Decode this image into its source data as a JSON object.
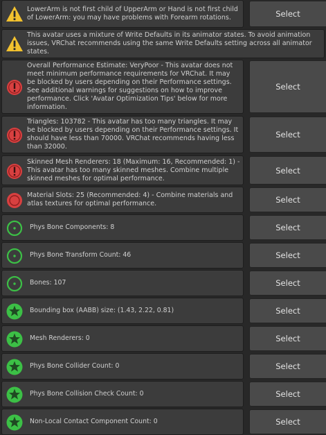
{
  "colors": {
    "warning": "#f2c12e",
    "error": "#d84040",
    "info_green": "#3cc046",
    "panel_bg": "#3c3c3c",
    "button_bg": "#4a4a4a"
  },
  "rows": [
    {
      "icon": "warning-icon",
      "text": "LowerArm is not first child of UpperArm or Hand is not first child of LowerArm: you may have problems with Forearm rotations.",
      "button": "Select"
    },
    {
      "icon": "warning-icon",
      "text": "This avatar uses a mixture of Write Defaults in its animator states. To avoid animation issues, VRChat recommends using the same Write Defaults setting across all animator states."
    },
    {
      "icon": "error-icon",
      "text": "Overall Performance Estimate: VeryPoor - This avatar does not meet minimum performance requirements for VRChat. It may be blocked by users depending on their Performance settings. See additional warnings for suggestions on how to improve performance. Click 'Avatar Optimization Tips' below for more information.",
      "button": "Select"
    },
    {
      "icon": "error-icon",
      "text": "Triangles: 103782 - This avatar has too many triangles. It may be blocked by users depending on their Performance settings. It should have less than 70000. VRChat recommends having less than 32000.",
      "button": "Select"
    },
    {
      "icon": "error-icon",
      "text": "Skinned Mesh Renderers: 18 (Maximum: 16, Recommended: 1) - This avatar has too many skinned meshes. Combine multiple skinned meshes for optimal performance.",
      "button": "Select"
    },
    {
      "icon": "error-dot-icon",
      "text": "Material Slots: 25 (Recommended: 4) - Combine materials and atlas textures for optimal performance.",
      "button": "Select"
    },
    {
      "icon": "good-circle-icon",
      "text": "Phys Bone Components: 8",
      "button": "Select"
    },
    {
      "icon": "good-circle-icon",
      "text": "Phys Bone Transform Count: 46",
      "button": "Select"
    },
    {
      "icon": "good-circle-icon",
      "text": "Bones: 107",
      "button": "Select"
    },
    {
      "icon": "excellent-star-icon",
      "text": "Bounding box (AABB) size: (1.43, 2.22, 0.81)",
      "button": "Select"
    },
    {
      "icon": "excellent-star-icon",
      "text": "Mesh Renderers: 0",
      "button": "Select"
    },
    {
      "icon": "excellent-star-icon",
      "text": "Phys Bone Collider Count: 0",
      "button": "Select"
    },
    {
      "icon": "excellent-star-icon",
      "text": "Phys Bone Collision Check Count: 0",
      "button": "Select"
    },
    {
      "icon": "excellent-star-icon",
      "text": "Non-Local Contact Component Count: 0",
      "button": "Select"
    }
  ]
}
